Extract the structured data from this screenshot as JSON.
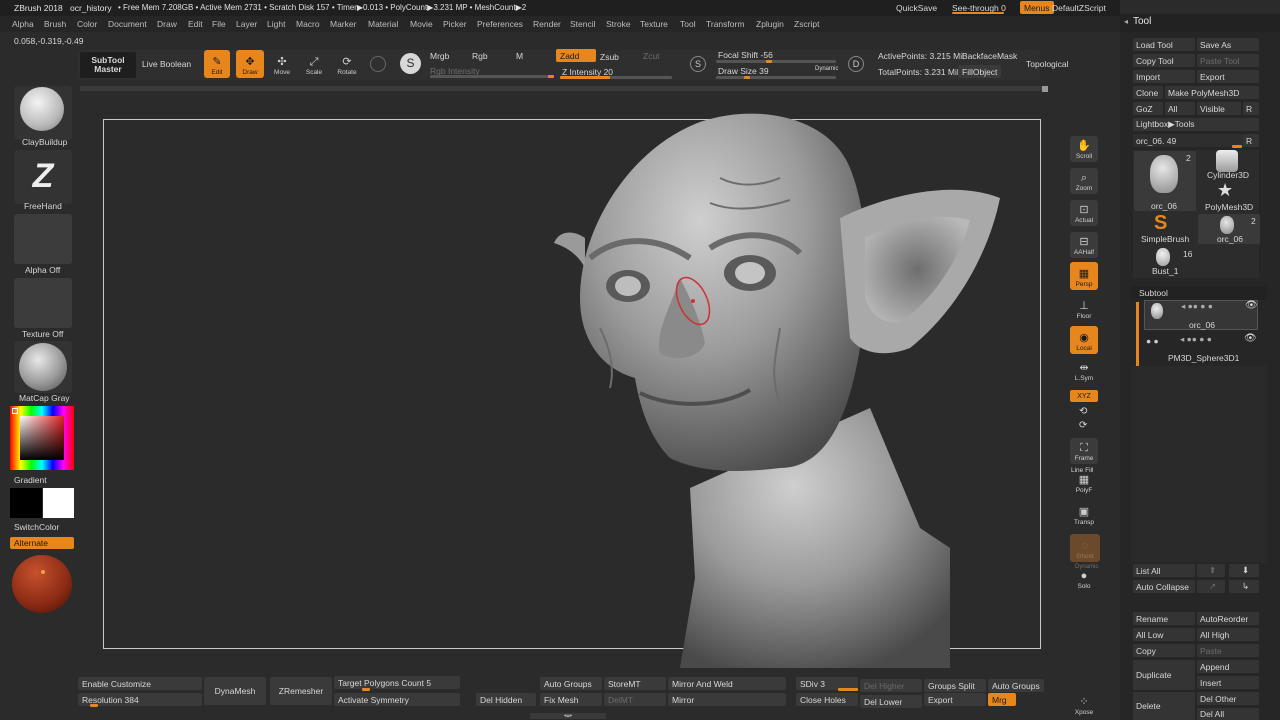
{
  "titlebar": {
    "app": "ZBrush 2018",
    "doc": "ocr_history",
    "stats": "• Free Mem 7.208GB • Active Mem 2731 • Scratch Disk 157 • Timer▶0.013 • PolyCount▶3.231 MP • MeshCount▶2",
    "quicksave": "QuickSave",
    "seethrough": "See-through  0",
    "menus": "Menus",
    "script": "DefaultZScript"
  },
  "menu": [
    "Alpha",
    "Brush",
    "Color",
    "Document",
    "Draw",
    "Edit",
    "File",
    "Layer",
    "Light",
    "Macro",
    "Marker",
    "Material",
    "Movie",
    "Picker",
    "Preferences",
    "Render",
    "Stencil",
    "Stroke",
    "Texture",
    "Tool",
    "Transform",
    "Zplugin",
    "Zscript"
  ],
  "coords": "0.058,-0.319,-0.49",
  "toolbar": {
    "subtool_master": "SubTool Master",
    "live_boolean": "Live Boolean",
    "edit": "Edit",
    "draw": "Draw",
    "move": "Move",
    "scale": "Scale",
    "rotate": "Rotate",
    "mrgb": "Mrgb",
    "rgb": "Rgb",
    "m": "M",
    "zadd": "Zadd",
    "zsub": "Zsub",
    "zcut": "Zcut",
    "rgb_intensity": "Rgb Intensity",
    "z_intensity": "Z Intensity 20",
    "focal_shift": "Focal Shift -56",
    "draw_size": "Draw Size 39",
    "dynamic": "Dynamic",
    "active_points": "ActivePoints: 3.215 Mil",
    "backface_mask": "BackfaceMask",
    "total_points": "TotalPoints: 3.231 Mil",
    "fill_object": "FillObject",
    "topological": "Topological"
  },
  "left_shelf": {
    "brush1": "ClayBuildup",
    "brush2": "FreeHand",
    "alpha": "Alpha Off",
    "texture": "Texture Off",
    "material": "MatCap Gray",
    "gradient": "Gradient",
    "switchcolor": "SwitchColor",
    "alternate": "Alternate"
  },
  "right_shelf": [
    "Scroll",
    "Zoom",
    "Actual",
    "AAHalf",
    "Persp",
    "Floor",
    "Local",
    "L.Sym",
    "XYZ",
    "Frame",
    "PolyF",
    "Transp",
    "Ghost",
    "Solo",
    "Xpose"
  ],
  "right_shelf_extra": {
    "linefill": "Line Fill",
    "dynamic": "Dynamic"
  },
  "bottom": {
    "enable_customize": "Enable Customize",
    "resolution": "Resolution 384",
    "dynamesh": "DynaMesh",
    "zremesher": "ZRemesher",
    "target_poly": "Target Polygons Count 5",
    "activate_symmetry": "Activate Symmetry",
    "del_hidden": "Del Hidden",
    "auto_groups": "Auto Groups",
    "fix_mesh": "Fix Mesh",
    "storemt": "StoreMT",
    "delmt": "DelMT",
    "mirror_weld": "Mirror And Weld",
    "mirror": "Mirror",
    "sdiv": "SDiv 3",
    "close_holes": "Close Holes",
    "del_higher": "Del Higher",
    "del_lower": "Del Lower",
    "groups_split": "Groups Split",
    "export": "Export",
    "auto_groups2": "Auto Groups",
    "mrg": "Mrg"
  },
  "tool_panel": {
    "title": "Tool",
    "load_tool": "Load Tool",
    "save_as": "Save As",
    "copy_tool": "Copy Tool",
    "paste_tool": "Paste Tool",
    "import": "Import",
    "export": "Export",
    "clone": "Clone",
    "make_polymesh": "Make PolyMesh3D",
    "goz": "GoZ",
    "all": "All",
    "visible": "Visible",
    "r": "R",
    "lightbox_tools": "Lightbox▶Tools",
    "current_tool": "orc_06. 49",
    "r2": "R",
    "thumbs": {
      "orc_big": "orc_06",
      "orc_big_count": "2",
      "cylinder": "Cylinder3D",
      "polymesh": "PolyMesh3D",
      "simplebrush": "SimpleBrush",
      "orc_small": "orc_06",
      "orc_small_count": "2",
      "bust": "Bust_1",
      "bust_count": "16"
    },
    "subtool_header": "Subtool",
    "subtool1": "orc_06",
    "subtool2": "PM3D_Sphere3D1",
    "list_all": "List All",
    "auto_collapse": "Auto Collapse",
    "rename": "Rename",
    "autoreorder": "AutoReorder",
    "all_low": "All Low",
    "all_high": "All High",
    "copy": "Copy",
    "paste": "Paste",
    "duplicate": "Duplicate",
    "append": "Append",
    "insert": "Insert",
    "delete": "Delete",
    "del_other": "Del Other",
    "del_all": "Del All"
  },
  "colors": {
    "accent": "#e8861e",
    "bg": "#2b2b2b",
    "panel": "#262626"
  }
}
